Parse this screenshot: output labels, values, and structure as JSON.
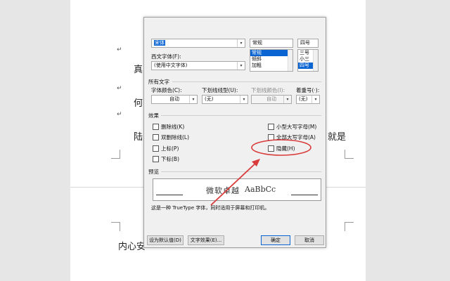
{
  "document": {
    "lines": [
      "真",
      "何",
      "陆",
      "就是",
      "内心安"
    ],
    "paragraph_mark": "↵"
  },
  "dialog": {
    "font_combo_value": "宋体",
    "style_list": {
      "header": "常规",
      "items": [
        "常规",
        "倾斜",
        "加粗"
      ],
      "selected": 0
    },
    "size_list": {
      "header": "四号",
      "items": [
        "三号",
        "小三",
        "四号"
      ],
      "selected": 2
    },
    "western_font": {
      "label": "西文字体(F):",
      "value": "(使用中文字体)"
    },
    "all_text": {
      "section": "所有文字",
      "font_color": {
        "label": "字体颜色(C):",
        "value": "自动"
      },
      "underline_style": {
        "label": "下划线线型(U):",
        "value": "(无)"
      },
      "underline_color": {
        "label": "下划线颜色(I):",
        "value": "自动"
      },
      "emphasis": {
        "label": "着重号(·):",
        "value": "(无)"
      }
    },
    "effects": {
      "section": "效果",
      "left": [
        "删除线(K)",
        "双删除线(L)",
        "上标(P)",
        "下标(B)"
      ],
      "right": [
        "小型大写字母(M)",
        "全部大写字母(A)",
        "隐藏(H)"
      ]
    },
    "preview": {
      "section": "预览",
      "sample_cn": "微软卓越",
      "sample_en": "AaBbCc",
      "note": "这是一种 TrueType 字体，同时适用于屏幕和打印机。"
    },
    "buttons": {
      "set_default": "设为默认值(D)",
      "text_effects": "文字效果(E)...",
      "ok": "确定",
      "cancel": "取消"
    }
  },
  "annotation": {
    "color": "#d93a3a"
  },
  "colors": {
    "selection": "#0a64d2",
    "dialog_bg": "#f0f0f0"
  }
}
